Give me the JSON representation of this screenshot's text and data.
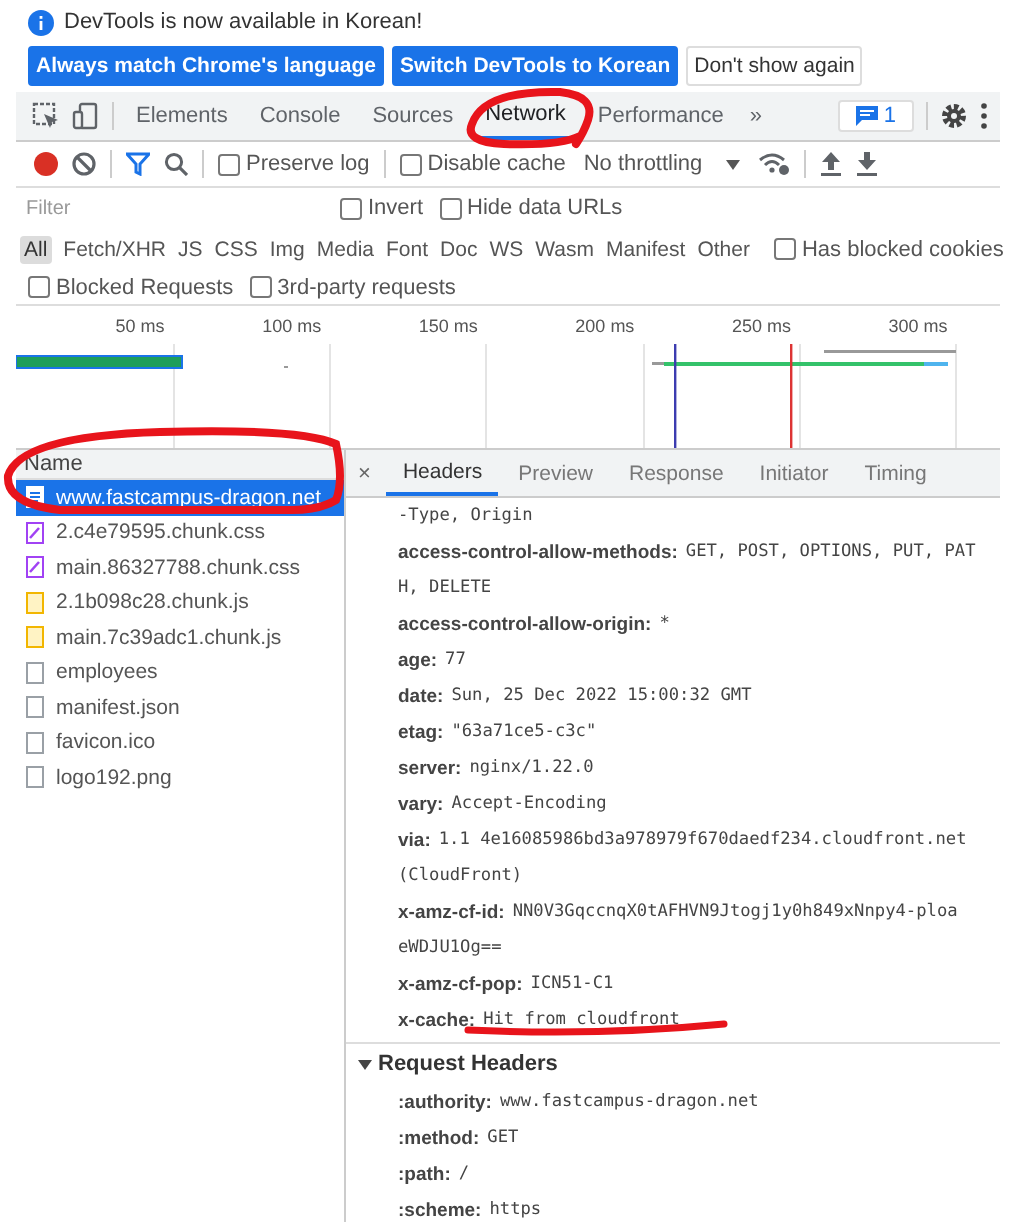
{
  "infobar": {
    "message": "DevTools is now available in Korean!",
    "buttons": [
      {
        "label": "Always match Chrome's language",
        "kind": "primary"
      },
      {
        "label": "Switch DevTools to Korean",
        "kind": "primary"
      },
      {
        "label": "Don't show again",
        "kind": "plain"
      }
    ]
  },
  "tabs": [
    {
      "label": "Elements",
      "selected": false
    },
    {
      "label": "Console",
      "selected": false
    },
    {
      "label": "Sources",
      "selected": false
    },
    {
      "label": "Network",
      "selected": true
    },
    {
      "label": "Performance",
      "selected": false
    }
  ],
  "more_tabs": "»",
  "issues_badge": "1",
  "toolbar": {
    "checkboxes": [
      {
        "label": "Preserve log",
        "checked": false
      },
      {
        "label": "Disable cache",
        "checked": false
      }
    ],
    "throttling": "No throttling"
  },
  "filter": {
    "placeholder": "Filter",
    "checkboxes": [
      {
        "label": "Invert",
        "checked": false
      },
      {
        "label": "Hide data URLs",
        "checked": false
      }
    ]
  },
  "type_filters": [
    {
      "label": "All",
      "selected": true
    },
    {
      "label": "Fetch/XHR",
      "selected": false
    },
    {
      "label": "JS",
      "selected": false
    },
    {
      "label": "CSS",
      "selected": false
    },
    {
      "label": "Img",
      "selected": false
    },
    {
      "label": "Media",
      "selected": false
    },
    {
      "label": "Font",
      "selected": false
    },
    {
      "label": "Doc",
      "selected": false
    },
    {
      "label": "WS",
      "selected": false
    },
    {
      "label": "Wasm",
      "selected": false
    },
    {
      "label": "Manifest",
      "selected": false
    },
    {
      "label": "Other",
      "selected": false
    }
  ],
  "type_checkbox": {
    "label": "Has blocked cookies",
    "checked": false
  },
  "request_checkboxes": [
    {
      "label": "Blocked Requests",
      "checked": false
    },
    {
      "label": "3rd-party requests",
      "checked": false
    }
  ],
  "overview": {
    "ticks": [
      "50 ms",
      "100 ms",
      "150 ms",
      "200 ms",
      "250 ms",
      "300 ms"
    ]
  },
  "requests": {
    "column": "Name",
    "rows": [
      {
        "name": "www.fastcampus-dragon.net",
        "kind": "document",
        "selected": true
      },
      {
        "name": "2.c4e79595.chunk.css",
        "kind": "css",
        "selected": false
      },
      {
        "name": "main.86327788.chunk.css",
        "kind": "css",
        "selected": false
      },
      {
        "name": "2.1b098c28.chunk.js",
        "kind": "js",
        "selected": false
      },
      {
        "name": "main.7c39adc1.chunk.js",
        "kind": "js",
        "selected": false
      },
      {
        "name": "employees",
        "kind": "other",
        "selected": false
      },
      {
        "name": "manifest.json",
        "kind": "other",
        "selected": false
      },
      {
        "name": "favicon.ico",
        "kind": "other",
        "selected": false
      },
      {
        "name": "logo192.png",
        "kind": "other",
        "selected": false
      }
    ]
  },
  "details": {
    "close": "×",
    "tabs": [
      {
        "label": "Headers",
        "selected": true
      },
      {
        "label": "Preview",
        "selected": false
      },
      {
        "label": "Response",
        "selected": false
      },
      {
        "label": "Initiator",
        "selected": false
      },
      {
        "label": "Timing",
        "selected": false
      }
    ],
    "response_headers": [
      {
        "lines": [
          "-Type, Origin"
        ]
      },
      {
        "name": "access-control-allow-methods:",
        "lines": [
          "GET, POST, OPTIONS, PUT, PAT",
          "H, DELETE"
        ]
      },
      {
        "name": "access-control-allow-origin:",
        "lines": [
          "*"
        ]
      },
      {
        "name": "age:",
        "lines": [
          "77"
        ]
      },
      {
        "name": "date:",
        "lines": [
          "Sun, 25 Dec 2022 15:00:32 GMT"
        ]
      },
      {
        "name": "etag:",
        "lines": [
          "\"63a71ce5-c3c\""
        ]
      },
      {
        "name": "server:",
        "lines": [
          "nginx/1.22.0"
        ]
      },
      {
        "name": "vary:",
        "lines": [
          "Accept-Encoding"
        ]
      },
      {
        "name": "via:",
        "lines": [
          "1.1 4e16085986bd3a978979f670daedf234.cloudfront.net",
          "(CloudFront)"
        ]
      },
      {
        "name": "x-amz-cf-id:",
        "lines": [
          "NN0V3GqccnqX0tAFHVN9Jtogj1y0h849xNnpy4-ploa",
          "eWDJU1Og=="
        ]
      },
      {
        "name": "x-amz-cf-pop:",
        "lines": [
          "ICN51-C1"
        ]
      },
      {
        "name": "x-cache:",
        "lines": [
          "Hit from cloudfront"
        ]
      }
    ],
    "request_section": {
      "title": "Request Headers",
      "expanded": true,
      "headers": [
        {
          "name": ":authority:",
          "lines": [
            "www.fastcampus-dragon.net"
          ]
        },
        {
          "name": ":method:",
          "lines": [
            "GET"
          ]
        },
        {
          "name": ":path:",
          "lines": [
            "/"
          ]
        },
        {
          "name": ":scheme:",
          "lines": [
            "https"
          ]
        }
      ]
    }
  }
}
